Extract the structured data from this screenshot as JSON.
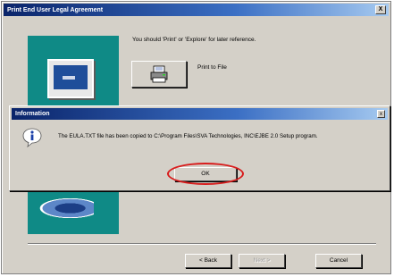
{
  "main_window": {
    "title": "Print End User Legal Agreement",
    "close_label": "X",
    "instruction": "You should 'Print' or 'Explore' for later reference.",
    "print_label": "Print to File",
    "buttons": {
      "back": "< Back",
      "next": "Next >",
      "cancel": "Cancel"
    }
  },
  "info_dialog": {
    "title": "Information",
    "close_label": "x",
    "message": "The EULA.TXT file has been copied to C:\\Program Files\\SVA Technologies, INC\\EJBE 2.0 Setup program.",
    "ok_label": "OK"
  },
  "colors": {
    "title_bar_start": "#0a246a",
    "title_bar_end": "#a6caf0",
    "panel_bg": "#d4d0c8",
    "side_panel": "#0f8a86",
    "highlight": "#d81c1c"
  },
  "icons": {
    "printer": "printer-icon",
    "info": "info-icon"
  }
}
